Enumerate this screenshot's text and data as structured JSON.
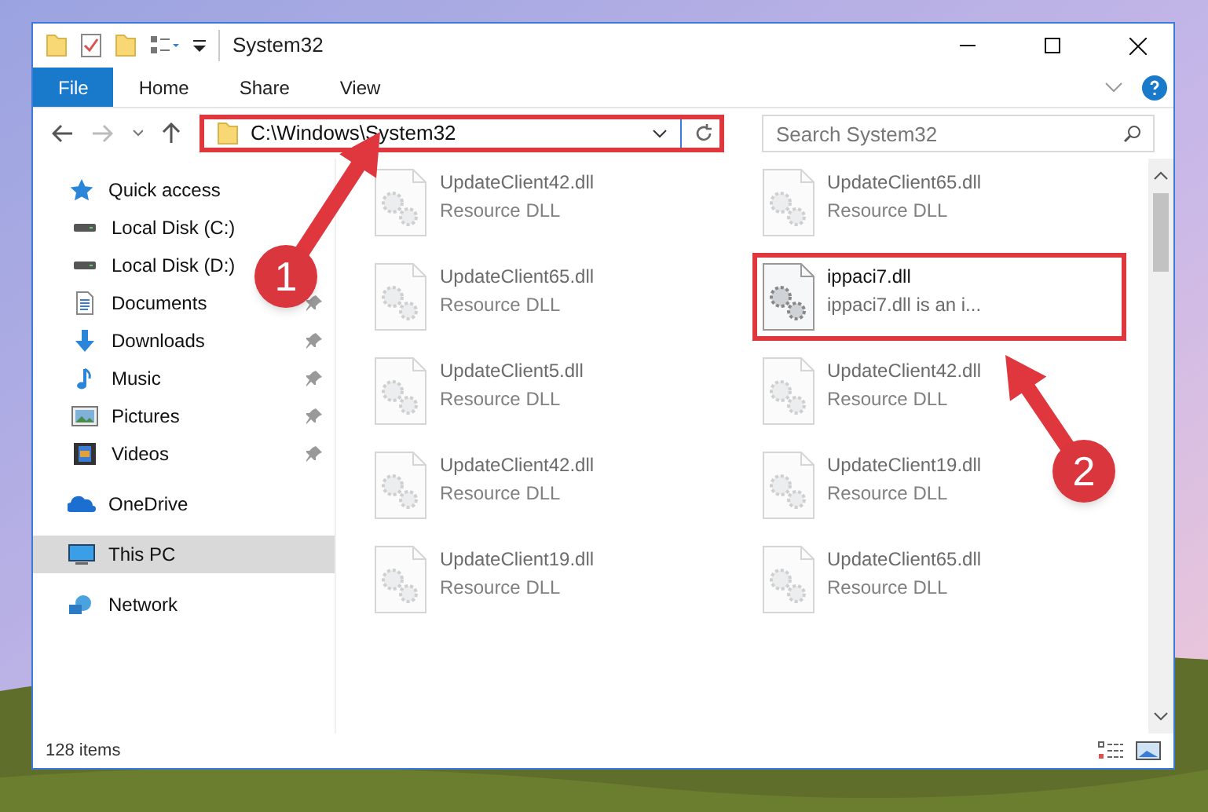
{
  "window": {
    "title": "System32"
  },
  "ribbon": {
    "tabs": [
      {
        "label": "File",
        "kind": "file"
      },
      {
        "label": "Home",
        "kind": "tab"
      },
      {
        "label": "Share",
        "kind": "tab"
      },
      {
        "label": "View",
        "kind": "tab"
      }
    ]
  },
  "address_bar": {
    "path": "C:\\Windows\\System32",
    "highlighted": true
  },
  "search": {
    "placeholder": "Search System32"
  },
  "sidebar": {
    "items": [
      {
        "label": "Quick access",
        "kind": "star",
        "selected": false,
        "children": [
          {
            "label": "Local Disk (C:)",
            "kind": "drive",
            "pinned": false
          },
          {
            "label": "Local Disk (D:)",
            "kind": "drive",
            "pinned": false
          },
          {
            "label": "Documents",
            "kind": "documents",
            "pinned": true
          },
          {
            "label": "Downloads",
            "kind": "downloads",
            "pinned": true
          },
          {
            "label": "Music",
            "kind": "music",
            "pinned": true
          },
          {
            "label": "Pictures",
            "kind": "pictures",
            "pinned": true
          },
          {
            "label": "Videos",
            "kind": "videos",
            "pinned": true
          }
        ]
      },
      {
        "label": "OneDrive",
        "kind": "cloud",
        "selected": false
      },
      {
        "label": "This PC",
        "kind": "pc",
        "selected": true
      },
      {
        "label": "Network",
        "kind": "network",
        "selected": false
      }
    ]
  },
  "files": [
    {
      "name": "UpdateClient42.dll",
      "description": "Resource DLL",
      "blurred": true,
      "highlighted": false
    },
    {
      "name": "UpdateClient65.dll",
      "description": "Resource DLL",
      "blurred": true,
      "highlighted": false
    },
    {
      "name": "UpdateClient65.dll",
      "description": "Resource DLL",
      "blurred": true,
      "highlighted": false
    },
    {
      "name": "ippaci7.dll",
      "description": "ippaci7.dll is an i...",
      "blurred": false,
      "highlighted": true
    },
    {
      "name": "UpdateClient5.dll",
      "description": "Resource DLL",
      "blurred": true,
      "highlighted": false
    },
    {
      "name": "UpdateClient42.dll",
      "description": "Resource DLL",
      "blurred": true,
      "highlighted": false
    },
    {
      "name": "UpdateClient42.dll",
      "description": "Resource DLL",
      "blurred": true,
      "highlighted": false
    },
    {
      "name": "UpdateClient19.dll",
      "description": "Resource DLL",
      "blurred": true,
      "highlighted": false
    },
    {
      "name": "UpdateClient19.dll",
      "description": "Resource DLL",
      "blurred": true,
      "highlighted": false
    },
    {
      "name": "UpdateClient65.dll",
      "description": "Resource DLL",
      "blurred": true,
      "highlighted": false
    }
  ],
  "status_bar": {
    "item_count": "128 items"
  },
  "callouts": [
    {
      "number": "1"
    },
    {
      "number": "2"
    }
  ]
}
